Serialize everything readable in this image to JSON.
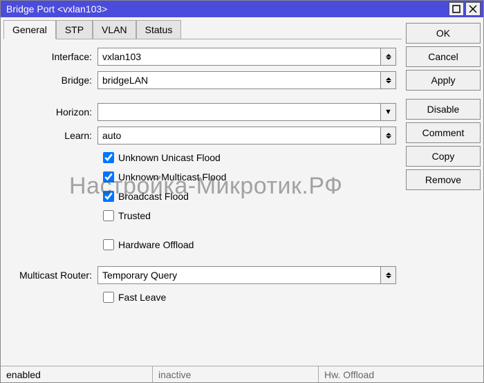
{
  "window": {
    "title": "Bridge Port <vxlan103>"
  },
  "tabs": [
    "General",
    "STP",
    "VLAN",
    "Status"
  ],
  "fields": {
    "interface": {
      "label": "Interface:",
      "value": "vxlan103"
    },
    "bridge": {
      "label": "Bridge:",
      "value": "bridgeLAN"
    },
    "horizon": {
      "label": "Horizon:",
      "value": ""
    },
    "learn": {
      "label": "Learn:",
      "value": "auto"
    },
    "unknown_unicast": {
      "label": "Unknown Unicast Flood",
      "checked": true
    },
    "unknown_multicast": {
      "label": "Unknown Multicast Flood",
      "checked": true
    },
    "broadcast_flood": {
      "label": "Broadcast Flood",
      "checked": true
    },
    "trusted": {
      "label": "Trusted",
      "checked": false
    },
    "hardware_offload": {
      "label": "Hardware Offload",
      "checked": false
    },
    "multicast_router": {
      "label": "Multicast Router:",
      "value": "Temporary Query"
    },
    "fast_leave": {
      "label": "Fast Leave",
      "checked": false
    }
  },
  "buttons": {
    "ok": "OK",
    "cancel": "Cancel",
    "apply": "Apply",
    "disable": "Disable",
    "comment": "Comment",
    "copy": "Copy",
    "remove": "Remove"
  },
  "status": {
    "enabled": "enabled",
    "inactive": "inactive",
    "hw_offload": "Hw. Offload"
  },
  "watermark": "Настройка-Микротик.РФ"
}
